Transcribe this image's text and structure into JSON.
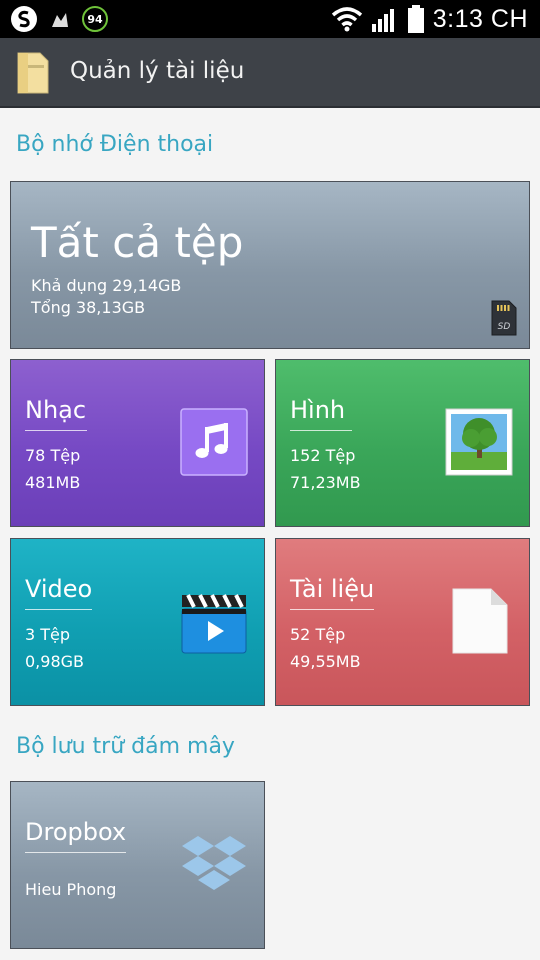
{
  "status_bar": {
    "time": "3:13 CH",
    "notification_badge": "94",
    "icons": [
      "s-logo-icon",
      "recycle-icon",
      "badge-icon",
      "wifi-icon",
      "signal-icon",
      "battery-icon"
    ]
  },
  "app_bar": {
    "title": "Quản lý tài liệu",
    "icon": "folder-icon"
  },
  "sections": {
    "phone_storage": "Bộ nhớ Điện thoại",
    "cloud_storage": "Bộ lưu trữ đám mây"
  },
  "tiles": {
    "all_files": {
      "title": "Tất cả tệp",
      "available": "Khả dụng 29,14GB",
      "total": "Tổng 38,13GB",
      "icon": "sd-card-icon"
    },
    "music": {
      "title": "Nhạc",
      "count": "78 Tệp",
      "size": "481MB",
      "icon": "music-note-icon",
      "color": "#7649c4"
    },
    "pictures": {
      "title": "Hình",
      "count": "152 Tệp",
      "size": "71,23MB",
      "icon": "picture-icon",
      "color": "#3aa659"
    },
    "video": {
      "title": "Video",
      "count": "3 Tệp",
      "size": "0,98GB",
      "icon": "clapperboard-icon",
      "color": "#109fb2"
    },
    "documents": {
      "title": "Tài liệu",
      "count": "52 Tệp",
      "size": "49,55MB",
      "icon": "document-icon",
      "color": "#d36166"
    },
    "dropbox": {
      "title": "Dropbox",
      "account": "Hieu Phong",
      "icon": "dropbox-icon"
    }
  }
}
